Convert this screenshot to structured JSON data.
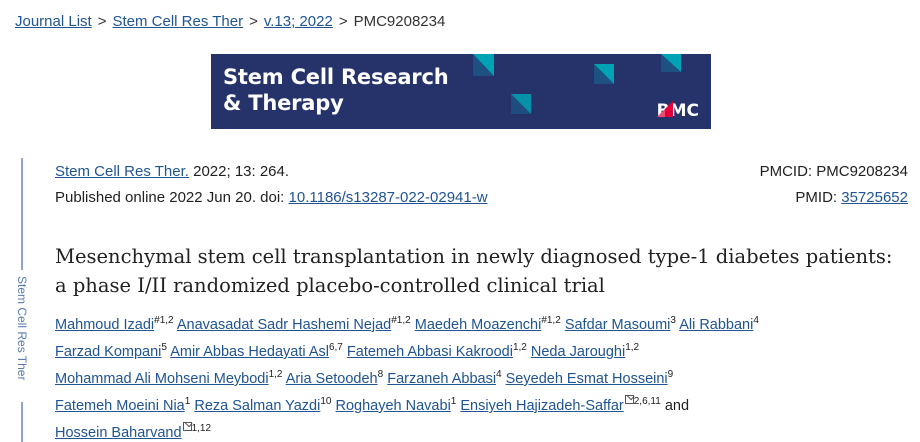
{
  "breadcrumb": {
    "items": [
      "Journal List",
      "Stem Cell Res Ther",
      "v.13; 2022"
    ],
    "current": "PMC9208234",
    "separator": ">"
  },
  "banner": {
    "title_line1": "Stem Cell Research",
    "title_line2": "& Therapy",
    "publisher": "BMC",
    "bg_color": "#26336b",
    "accent_color": "#00a3b4"
  },
  "side_label": "Stem Cell Res Ther",
  "citation": {
    "journal": "Stem Cell Res Ther.",
    "details": " 2022; 13: 264.",
    "published_prefix": "Published online 2022 Jun 20. doi: ",
    "doi": "10.1186/s13287-022-02941-w",
    "pmcid_label": "PMCID: PMC9208234",
    "pmid_label": "PMID: ",
    "pmid": "35725652"
  },
  "article": {
    "title_line1": "Mesenchymal stem cell transplantation in newly diagnosed type-1 diabetes patients:",
    "title_line2": "a phase I/II randomized placebo-controlled clinical trial"
  },
  "authors": [
    {
      "name": "Mahmoud Izadi",
      "sup": "#1,2"
    },
    {
      "name": "Anavasadat Sadr Hashemi Nejad",
      "sup": "#1,2"
    },
    {
      "name": "Maedeh Moazenchi",
      "sup": "#1,2"
    },
    {
      "name": "Safdar Masoumi",
      "sup": "3"
    },
    {
      "name": "Ali Rabbani",
      "sup": "4"
    },
    {
      "name": "Farzad Kompani",
      "sup": "5"
    },
    {
      "name": "Amir Abbas Hedayati Asl",
      "sup": "6,7"
    },
    {
      "name": "Fatemeh Abbasi Kakroodi",
      "sup": "1,2"
    },
    {
      "name": "Neda Jaroughi",
      "sup": "1,2"
    },
    {
      "name": "Mohammad Ali Mohseni Meybodi",
      "sup": "1,2"
    },
    {
      "name": "Aria Setoodeh",
      "sup": "8"
    },
    {
      "name": "Farzaneh Abbasi",
      "sup": "4"
    },
    {
      "name": "Seyedeh Esmat Hosseini",
      "sup": "9"
    },
    {
      "name": "Fatemeh Moeini Nia",
      "sup": "1"
    },
    {
      "name": "Reza Salman Yazdi",
      "sup": "10"
    },
    {
      "name": "Roghayeh Navabi",
      "sup": "1"
    },
    {
      "name": "Ensiyeh Hajizadeh-Saffar",
      "sup": "2,6,11"
    },
    {
      "name": "Hossein Baharvand",
      "sup": "1,12"
    }
  ],
  "authors_and": "and"
}
